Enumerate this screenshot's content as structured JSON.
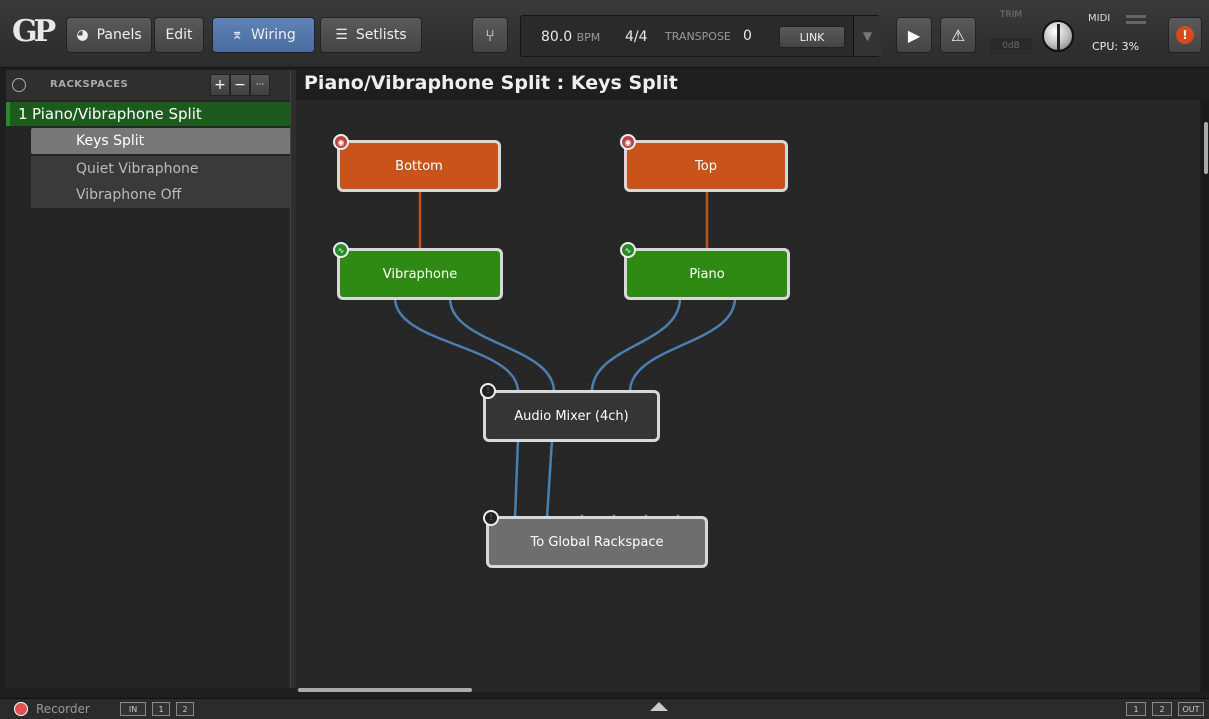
{
  "toolbar": {
    "logo_text": "GP",
    "panels_label": "Panels",
    "edit_label": "Edit",
    "wiring_label": "Wiring",
    "setlists_label": "Setlists",
    "bpm_value": "80.0",
    "bpm_unit": "BPM",
    "time_signature": "4/4",
    "transpose_label": "TRANSPOSE",
    "transpose_value": "0",
    "link_label": "LINK",
    "trim_label": "TRIM",
    "trim_value": "0dB",
    "midi_label": "MIDI",
    "cpu_label": "CPU: 3%"
  },
  "sidebar": {
    "title": "RACKSPACES",
    "add_label": "+",
    "remove_label": "−",
    "more_label": "···",
    "rackspace": {
      "number": "1",
      "name": "Piano/Vibraphone Split"
    },
    "variations": [
      {
        "label": "Keys Split",
        "selected": true
      },
      {
        "label": "Quiet Vibraphone",
        "selected": false
      },
      {
        "label": "Vibraphone Off",
        "selected": false
      }
    ]
  },
  "main": {
    "title": "Piano/Vibraphone Split : Keys Split",
    "nodes": {
      "bottom": "Bottom",
      "top": "Top",
      "vibraphone": "Vibraphone",
      "piano": "Piano",
      "mixer": "Audio Mixer (4ch)",
      "global": "To Global Rackspace"
    },
    "colors": {
      "midi_node": "#c8541c",
      "plugin_node": "#2f8a14",
      "audio_wire": "#4a7fb0",
      "midi_wire": "#c0501c"
    }
  },
  "footer": {
    "recorder_label": "Recorder",
    "in_label": "IN",
    "in_ch1": "1",
    "in_ch2": "2",
    "out_ch1": "1",
    "out_ch2": "2",
    "out_label": "OUT"
  }
}
